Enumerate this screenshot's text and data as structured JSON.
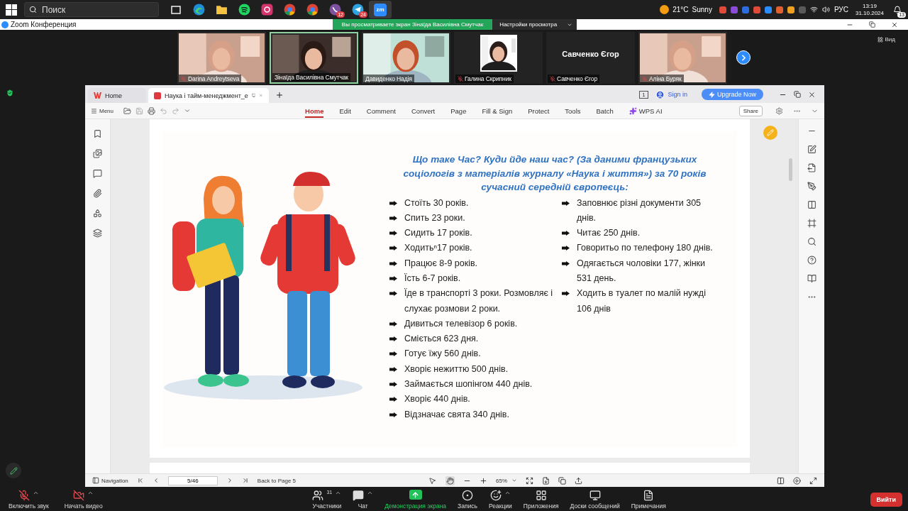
{
  "taskbar": {
    "search": {
      "placeholder": "Поиск"
    },
    "apps": [
      {
        "kind": "taskview",
        "selected": false
      },
      {
        "kind": "edge",
        "selected": false
      },
      {
        "kind": "files",
        "selected": false
      },
      {
        "kind": "spotify",
        "selected": false
      },
      {
        "kind": "instagram",
        "selected": false
      },
      {
        "kind": "chrome",
        "selected": false
      },
      {
        "kind": "chrome",
        "selected": false
      },
      {
        "kind": "viber",
        "badge": "12",
        "selected": false
      },
      {
        "kind": "telegram",
        "badge": "24",
        "selected": false
      },
      {
        "kind": "zoom",
        "label": "zm",
        "selected": true
      }
    ],
    "weather": {
      "temperature": "21°C",
      "condition": "Sunny"
    },
    "language": "РУС",
    "time": "13:19",
    "date": "31.10.2024",
    "notification_count": "13"
  },
  "window": {
    "title": "Zoom Конференция"
  },
  "share_banner": {
    "message": "Вы просматриваете экран Зінаїда Василівна Смутчак",
    "settings": "Настройки просмотра"
  },
  "view_button": "Вид",
  "participants": [
    {
      "name": "Darina Andreytseva",
      "muted": true,
      "speaking": false,
      "kind": "video"
    },
    {
      "name": "Зінаїда Василівна Смутчак",
      "muted": false,
      "speaking": true,
      "kind": "video"
    },
    {
      "name": "Давиденко Надія",
      "muted": false,
      "speaking": false,
      "kind": "video"
    },
    {
      "name": "Галина Скрипник",
      "muted": true,
      "speaking": false
    },
    {
      "name": "Савченко Єгор",
      "display_name": "Савченко Єгор",
      "muted": true,
      "speaking": false,
      "kind": "name"
    },
    {
      "name": "Аліна Буряк",
      "muted": true,
      "speaking": false,
      "kind": "video"
    }
  ],
  "document_window": {
    "tabs": [
      {
        "label": "Home",
        "kind": "home",
        "selected": false
      },
      {
        "label": "Наука і тайм-менеджмент_е",
        "kind": "pdf",
        "selected": true
      }
    ],
    "window_count": "1",
    "sign_in": "Sign in",
    "upgrade": "Upgrade Now",
    "menu": "Menu",
    "ribbon": [
      {
        "label": "Home",
        "kind": "tab",
        "selected": true
      },
      {
        "label": "Edit",
        "kind": "tab",
        "selected": false
      },
      {
        "label": "Comment",
        "kind": "tab",
        "selected": false
      },
      {
        "label": "Convert",
        "kind": "tab",
        "selected": false
      },
      {
        "label": "Page",
        "kind": "tab",
        "selected": false
      },
      {
        "label": "Fill & Sign",
        "kind": "tab",
        "selected": false
      },
      {
        "label": "Protect",
        "kind": "tab",
        "selected": false
      },
      {
        "label": "Tools",
        "kind": "tab",
        "selected": false
      },
      {
        "label": "Batch",
        "kind": "tab",
        "selected": false
      },
      {
        "label": "WPS AI",
        "kind": "ai",
        "selected": false
      }
    ],
    "share": "Share",
    "slide": {
      "title": "Що таке Час? Куди йде наш час? (За даними французьких соціологів з матеріалів журналу «Наука і життя») за 70 років сучасний середній європеєць:",
      "left_items": [
        "Стоїть 30 років.",
        "Спить 23 роки.",
        "Сидить 17 років.",
        "Ходитьⁿ17 років.",
        "Працює 8-9 років.",
        "Їсть 6-7 років.",
        "Їде в транспорті 3 роки. Розмовляє і слухає розмови 2 роки.",
        "Дивиться телевізор 6 років.",
        "Сміється 623 дня.",
        "Готує їжу 560 днів.",
        "Хворіє нежиттю 500 днів.",
        "Займається шопінгом 440 днів.",
        "Хворіє 440 днів.",
        "Відзначає свята 340 днів."
      ],
      "right_items": [
        "Заповнює різні документи 305 днів.",
        "Читає 250 днів.",
        "Говоритьо по телефону 180 днів.",
        "Одягається чоловіки 177, жінки 531 день.",
        "Ходить в туалет по малій нужді 106 днів"
      ]
    },
    "status_bar": {
      "navigation": "Navigation",
      "page": "5/46",
      "back_link": "Back to Page 5",
      "zoom": "65%",
      "tools": [
        {
          "kind": "select",
          "selected": false
        },
        {
          "kind": "hand",
          "selected": true
        }
      ]
    }
  },
  "meeting_toolbar": {
    "items": [
      {
        "kind": "mic",
        "label": "Включить звук",
        "caret": true
      },
      {
        "kind": "video",
        "label": "Начать видео",
        "caret": true
      },
      {
        "kind": "people",
        "label": "Участники",
        "count": "31",
        "caret": true
      },
      {
        "kind": "chat",
        "label": "Чат",
        "caret": true
      },
      {
        "kind": "share",
        "label": "Демонстрация экрана",
        "caret": false
      },
      {
        "kind": "record",
        "label": "Запись",
        "caret": false
      },
      {
        "kind": "reactions",
        "label": "Реакции",
        "caret": true
      },
      {
        "kind": "apps",
        "label": "Приложения",
        "caret": false
      },
      {
        "kind": "whiteboard",
        "label": "Доски сообщений",
        "caret": false
      },
      {
        "kind": "notes",
        "label": "Примечания",
        "caret": false
      }
    ],
    "leave": "Вийти"
  }
}
